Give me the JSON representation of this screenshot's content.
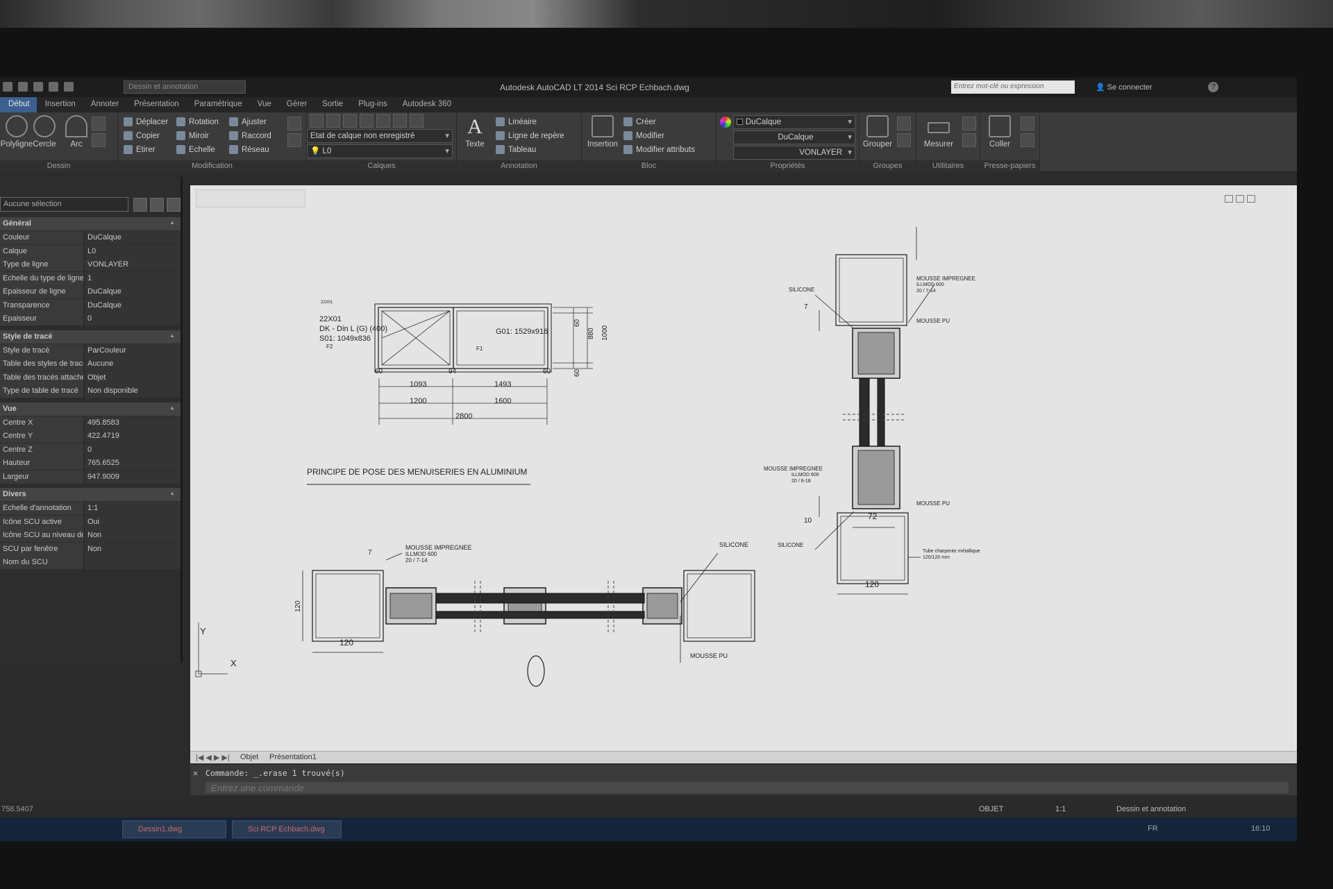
{
  "titlebar": {
    "workspace": "Dessin et annotation",
    "app_title": "Autodesk AutoCAD LT 2014    Sci RCP  Echbach.dwg",
    "search_placeholder": "Entrez mot-clé ou expression",
    "connect": "Se connecter",
    "help": "?"
  },
  "tabs": [
    "Début",
    "Insertion",
    "Annoter",
    "Présentation",
    "Paramétrique",
    "Vue",
    "Gérer",
    "Sortie",
    "Plug-ins",
    "Autodesk 360"
  ],
  "ribbon": {
    "dessin": {
      "title": "Dessin",
      "polyligne": "Polyligne",
      "cercle": "Cercle",
      "arc": "Arc"
    },
    "modification": {
      "title": "Modification",
      "deplacer": "Déplacer",
      "rotation": "Rotation",
      "ajuster": "Ajuster",
      "copier": "Copier",
      "miroir": "Miroir",
      "raccord": "Raccord",
      "etirer": "Etirer",
      "echelle": "Echelle",
      "reseau": "Réseau"
    },
    "calques": {
      "title": "Calques",
      "etat": "Etat de calque non enregistré",
      "layer": "L0"
    },
    "annotation": {
      "title": "Annotation",
      "texte": "Texte",
      "lineaire": "Linéaire",
      "repere": "Ligne de repère",
      "tableau": "Tableau"
    },
    "bloc": {
      "title": "Bloc",
      "insertion": "Insertion",
      "creer": "Créer",
      "modifier": "Modifier",
      "attributs": "Modifier attributs"
    },
    "proprietes": {
      "title": "Propriétés",
      "color": "DuCalque",
      "lineweight": "DuCalque",
      "linetype": "VONLAYER"
    },
    "groupes": {
      "title": "Groupes",
      "grouper": "Grouper"
    },
    "utilitaires": {
      "title": "Utilitaires",
      "mesurer": "Mesurer"
    },
    "presse": {
      "title": "Presse-papiers",
      "coller": "Coller"
    }
  },
  "props": {
    "selection": "Aucune sélection",
    "sections": [
      {
        "title": "Général",
        "rows": [
          [
            "Couleur",
            "DuCalque"
          ],
          [
            "Calque",
            "L0"
          ],
          [
            "Type de ligne",
            "VONLAYER"
          ],
          [
            "Echelle du type de ligne",
            "1"
          ],
          [
            "Epaisseur de ligne",
            "DuCalque"
          ],
          [
            "Transparence",
            "DuCalque"
          ],
          [
            "Epaisseur",
            "0"
          ]
        ]
      },
      {
        "title": "Style de tracé",
        "rows": [
          [
            "Style de tracé",
            "ParCouleur"
          ],
          [
            "Table des styles de tracé",
            "Aucune"
          ],
          [
            "Table des tracés attachée à",
            "Objet"
          ],
          [
            "Type de table de tracé",
            "Non disponible"
          ]
        ]
      },
      {
        "title": "Vue",
        "rows": [
          [
            "Centre X",
            "495.8583"
          ],
          [
            "Centre Y",
            "422.4719"
          ],
          [
            "Centre Z",
            "0"
          ],
          [
            "Hauteur",
            "765.6525"
          ],
          [
            "Largeur",
            "947.9009"
          ]
        ]
      },
      {
        "title": "Divers",
        "rows": [
          [
            "Echelle d'annotation",
            "1:1"
          ],
          [
            "Icône SCU active",
            "Oui"
          ],
          [
            "Icône SCU au niveau de l'...",
            "Non"
          ],
          [
            "SCU par fenêtre",
            "Non"
          ],
          [
            "Nom du SCU",
            ""
          ]
        ]
      }
    ]
  },
  "drawing": {
    "window_label_1": "22X01",
    "window_label_2": "DK - Din L (G) (400)",
    "window_label_3": "S01: 1049x836",
    "window_label_4": "G01: 1529x916",
    "tag_top": "22X01",
    "tag_f1": "F1",
    "tag_f2": "F2",
    "dim_60a": "60",
    "dim_94": "94",
    "dim_60b": "60",
    "dim_1093": "1093",
    "dim_1493": "1493",
    "dim_1200": "1200",
    "dim_1600": "1600",
    "dim_2800": "2800",
    "dim_v60a": "60",
    "dim_v880": "880",
    "dim_v1000": "1000",
    "dim_v60b": "60",
    "heading": "PRINCIPE DE POSE DES MENUISERIES EN ALUMINIUM",
    "h_dim_7": "7",
    "h_dim_120v": "120",
    "h_dim_120h": "120",
    "h_mousse_imp": "MOUSSE IMPREGNEE",
    "h_illmod": "ILLMOD 600",
    "h_illmod_spec": "20 / 7-14",
    "h_silicone": "SILICONE",
    "h_mousse_pu": "MOUSSE PU",
    "v_silicone_top": "SILICONE",
    "v_mousse_imp_top": "MOUSSE IMPREGNEE",
    "v_illmod_top": "ILLMOD 600",
    "v_spec_top": "20 / 7-14",
    "v_mousse_pu_top": "MOUSSE PU",
    "v_dim_7": "7",
    "v_mousse_imp_bot": "MOUSSE IMPREGNEE",
    "v_illmod_bot": "ILLMOD 600",
    "v_spec_bot": "20 / 8-18",
    "v_mousse_pu_bot": "MOUSSE PU",
    "v_dim_10": "10",
    "v_dim_72": "72",
    "v_silicone_bot": "SILICONE",
    "v_tube": "Tube charpente métallique",
    "v_tube_size": "120/120 mm",
    "v_dim_120": "120",
    "ucs_y": "Y",
    "ucs_x": "X"
  },
  "layout_tabs": [
    "Objet",
    "Présentation1"
  ],
  "command": {
    "history": "Commande: _.erase 1 trouvé(s)",
    "placeholder": "Entrez une commande"
  },
  "status": {
    "coords": "758.5407",
    "objet": "OBJET",
    "scale": "1:1",
    "workspace": "Dessin et annotation"
  },
  "taskbar": {
    "task1": "Dessin1.dwg",
    "task2": "Sci RCP  Echbach.dwg",
    "lang": "FR",
    "time": "16:10"
  }
}
